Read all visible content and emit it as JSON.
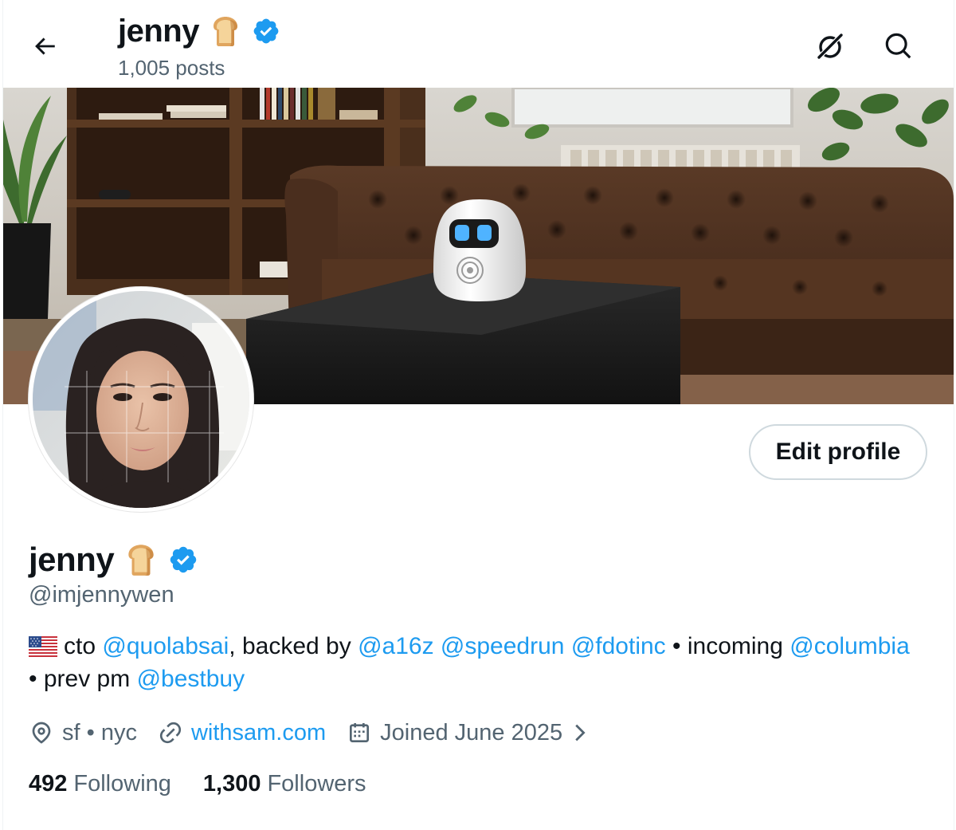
{
  "header": {
    "name": "jenny",
    "posts_count": "1,005 posts"
  },
  "profile": {
    "name": "jenny",
    "handle": "@imjennywen",
    "edit_label": "Edit profile",
    "bio": {
      "cto": "cto",
      "mention_quolabs": "@quolabsai",
      "backed_by": ", backed by",
      "mention_a16z": "@a16z",
      "mention_speedrun": "@speedrun",
      "mention_fdotinc": "@fdotinc",
      "incoming": "• incoming",
      "mention_columbia": "@columbia",
      "prev_pm": "• prev pm",
      "mention_bestbuy": "@bestbuy"
    },
    "location": "sf • nyc",
    "website": "withsam.com",
    "joined": "Joined June 2025",
    "following_count": "492",
    "following_label": "Following",
    "followers_count": "1,300",
    "followers_label": "Followers"
  },
  "icons": {
    "back": "arrow-left-icon",
    "grok": "grok-icon",
    "search": "search-icon",
    "verified": "verified-badge-icon",
    "emoji": "bread-emoji-icon",
    "flag": "us-flag-icon",
    "location": "location-pin-icon",
    "link": "link-icon",
    "calendar": "calendar-icon",
    "chevron": "chevron-right-icon"
  },
  "colors": {
    "accent": "#1d9bf0",
    "text_primary": "#0f1419",
    "text_secondary": "#536471",
    "border": "#cfd9de"
  }
}
